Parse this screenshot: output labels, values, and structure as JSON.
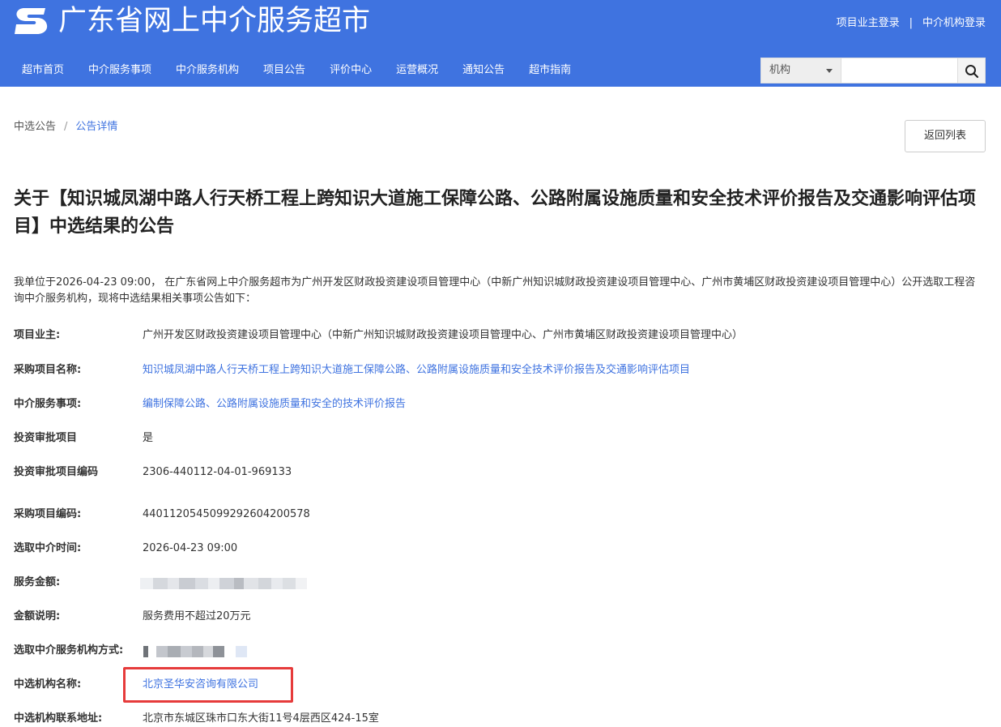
{
  "header": {
    "site_title": "广东省网上中介服务超市",
    "owner_login": "项目业主登录",
    "separator": "|",
    "agency_login": "中介机构登录",
    "bg_color": "#3f73e0"
  },
  "nav": {
    "items": [
      {
        "label": "超市首页"
      },
      {
        "label": "中介服务事项"
      },
      {
        "label": "中介服务机构"
      },
      {
        "label": "项目公告"
      },
      {
        "label": "评价中心"
      },
      {
        "label": "运营概况"
      },
      {
        "label": "通知公告"
      },
      {
        "label": "超市指南"
      }
    ]
  },
  "search": {
    "selected_option": "机构",
    "value": "",
    "icon": "search-icon"
  },
  "breadcrumb": {
    "first": "中选公告",
    "separator": "/",
    "second": "公告详情"
  },
  "back_button": "返回列表",
  "announcement": {
    "title": "关于【知识城凤湖中路人行天桥工程上跨知识大道施工保障公路、公路附属设施质量和安全技术评价报告及交通影响评估项目】中选结果的公告",
    "intro": "我单位于2026-04-23 09:00， 在广东省网上中介服务超市为广州开发区财政投资建设项目管理中心（中新广州知识城财政投资建设项目管理中心、广州市黄埔区财政投资建设项目管理中心）公开选取工程咨询中介服务机构，现将中选结果相关事项公告如下："
  },
  "fields": {
    "owner": {
      "label": "项目业主:",
      "value": "广州开发区财政投资建设项目管理中心（中新广州知识城财政投资建设项目管理中心、广州市黄埔区财政投资建设项目管理中心）"
    },
    "project_name": {
      "label": "采购项目名称:",
      "value": "知识城凤湖中路人行天桥工程上跨知识大道施工保障公路、公路附属设施质量和安全技术评价报告及交通影响评估项目"
    },
    "service_item": {
      "label": "中介服务事项:",
      "value": "编制保障公路、公路附属设施质量和安全的技术评价报告"
    },
    "investment_approval": {
      "label": "投资审批项目",
      "value": "是"
    },
    "approval_code": {
      "label": "投资审批项目编码",
      "value": "2306-440112-04-01-969133"
    },
    "purchase_code": {
      "label": "采购项目编码:",
      "value": "440112054509929260420057​8"
    },
    "selection_time": {
      "label": "选取中介时间:",
      "value": "2026-04-23 09:00"
    },
    "service_amount": {
      "label": "服务金额:",
      "value": ""
    },
    "amount_note": {
      "label": "金额说明:",
      "value": "服务费用不超过20万元"
    },
    "selection_method": {
      "label": "选取中介服务机构方式:",
      "value": ""
    },
    "agency_name": {
      "label": "中选机构名称:",
      "value": "北京圣华安咨询有限公司"
    },
    "agency_address": {
      "label": "中选机构联系地址:",
      "value": "北京市东城区珠市口东大街11号4层西区424-15室"
    }
  },
  "colors": {
    "link": "#3f73e0",
    "highlight_border": "#e63b3b"
  }
}
